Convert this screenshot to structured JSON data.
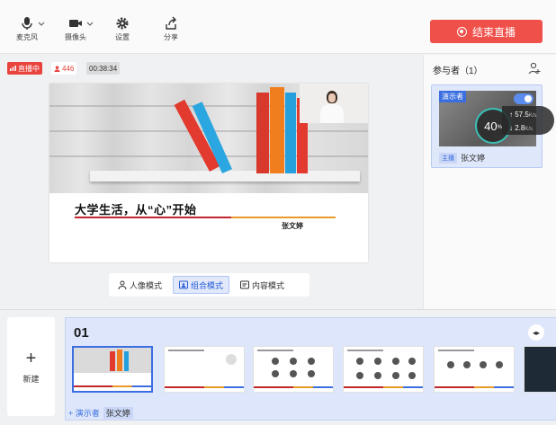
{
  "toolbar": {
    "mic_label": "麦克风",
    "camera_label": "摄像头",
    "settings_label": "设置",
    "share_label": "分享",
    "end_live_label": "结束直播"
  },
  "status": {
    "live_label": "直播中",
    "viewer_count": "446",
    "elapsed": "00:38:34"
  },
  "slide": {
    "title": "大学生活，从“心”开始",
    "author": "张文婷"
  },
  "modes": {
    "portrait": "人像模式",
    "combined": "组合模式",
    "content": "内容模式"
  },
  "participants": {
    "title": "参与者（1）",
    "card": {
      "role_tag": "演示者",
      "cpu_percent": "40",
      "cpu_unit": "%",
      "upload_speed": "57.5",
      "download_speed": "2.8",
      "speed_unit": "K/s",
      "host_tag": "主播",
      "name": "张文婷"
    }
  },
  "bottom": {
    "new_label": "新建",
    "group_number": "01",
    "add_presenter_label": "+ 演示者",
    "presenter_name": "张文婷"
  },
  "colors": {
    "accent": "#3b6fe0",
    "end_button": "#f0504a",
    "live_red": "#e8433d"
  }
}
